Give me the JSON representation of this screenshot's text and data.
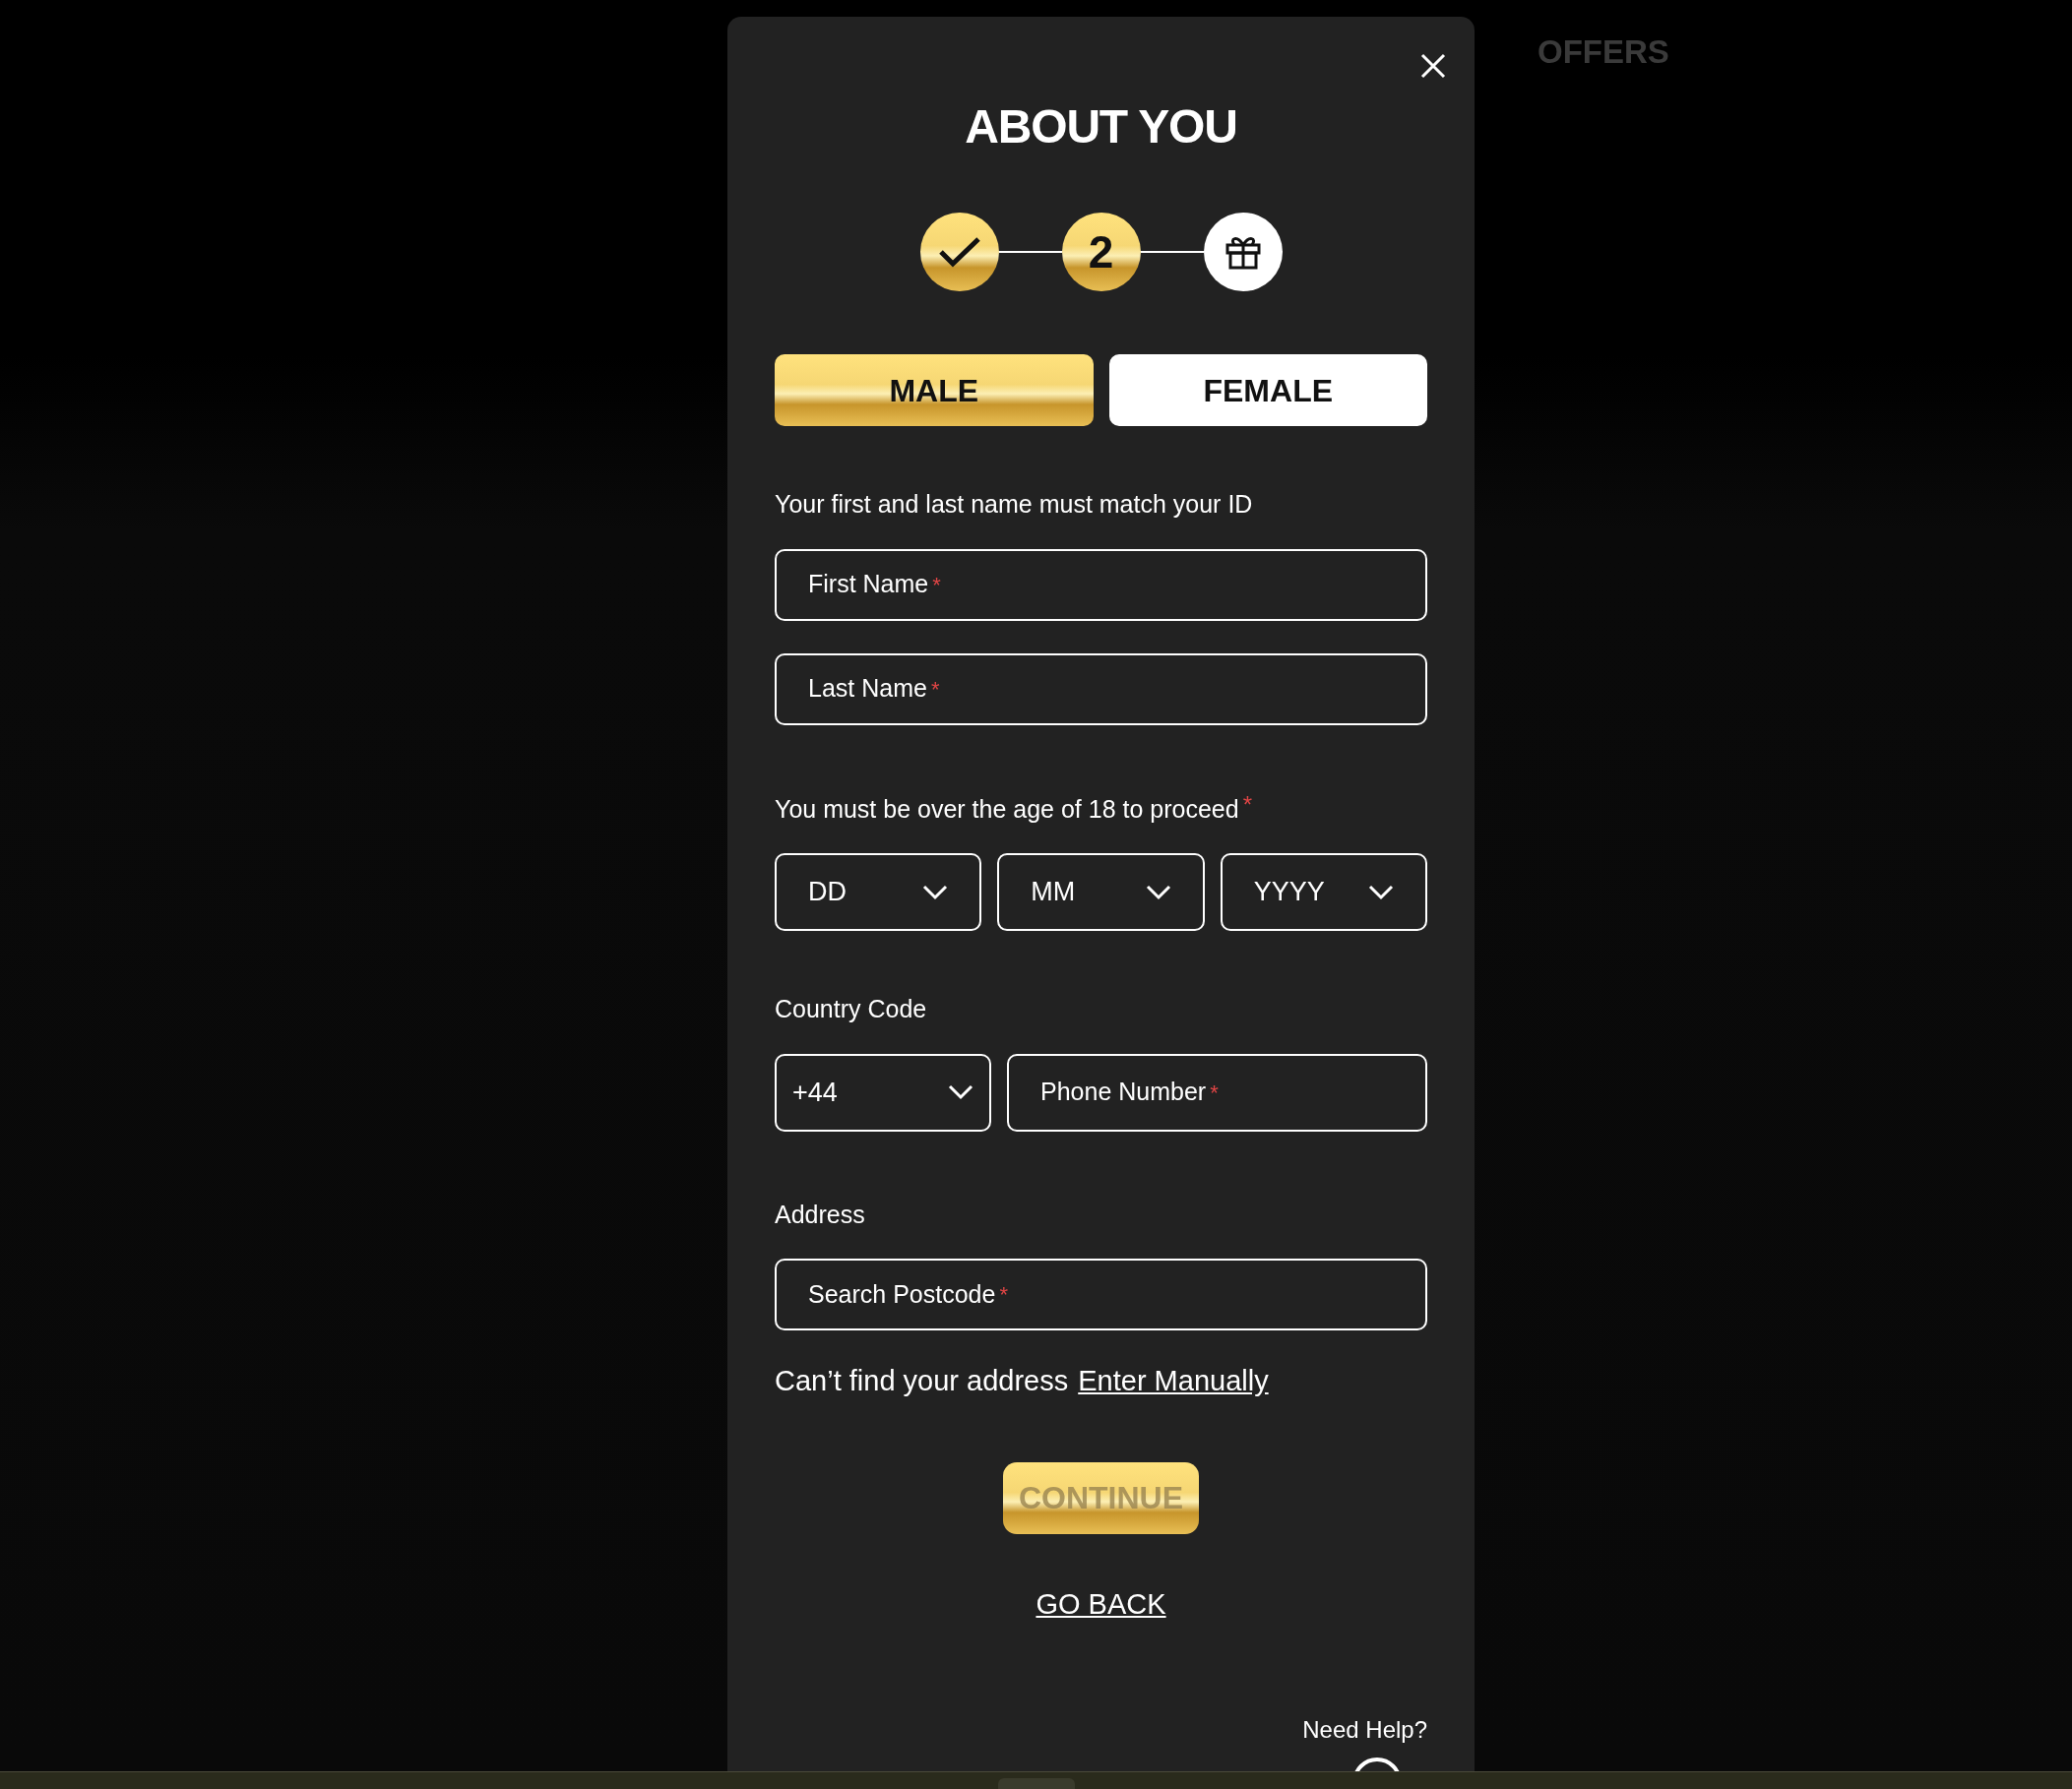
{
  "background_nav": {
    "label": "OFFERS"
  },
  "modal": {
    "title": "ABOUT YOU",
    "steps": [
      {
        "kind": "done"
      },
      {
        "kind": "current",
        "label": "2"
      },
      {
        "kind": "reward"
      }
    ],
    "gender": [
      {
        "label": "MALE",
        "selected": true
      },
      {
        "label": "FEMALE",
        "selected": false
      }
    ],
    "name_hint": "Your first and last name must match your ID",
    "name_fields": [
      {
        "placeholder": "First Name",
        "required_mark": "*"
      },
      {
        "placeholder": "Last Name",
        "required_mark": "*"
      }
    ],
    "age_hint": "You must be over the age of 18 to proceed",
    "age_required_mark": "*",
    "date_selects": [
      {
        "placeholder": "DD"
      },
      {
        "placeholder": "MM"
      },
      {
        "placeholder": "YYYY"
      }
    ],
    "country_code_label": "Country Code",
    "country_code": {
      "value": "+44"
    },
    "phone_field": {
      "placeholder": "Phone Number",
      "required_mark": "*"
    },
    "address_label": "Address",
    "postcode_field": {
      "placeholder": "Search Postcode",
      "required_mark": "*"
    },
    "address_help": "Can’t find your address",
    "enter_manually": "Enter Manually",
    "continue_button": {
      "label": "CONTINUE",
      "disabled": true
    },
    "go_back": "GO BACK",
    "need_help": "Need Help?"
  }
}
